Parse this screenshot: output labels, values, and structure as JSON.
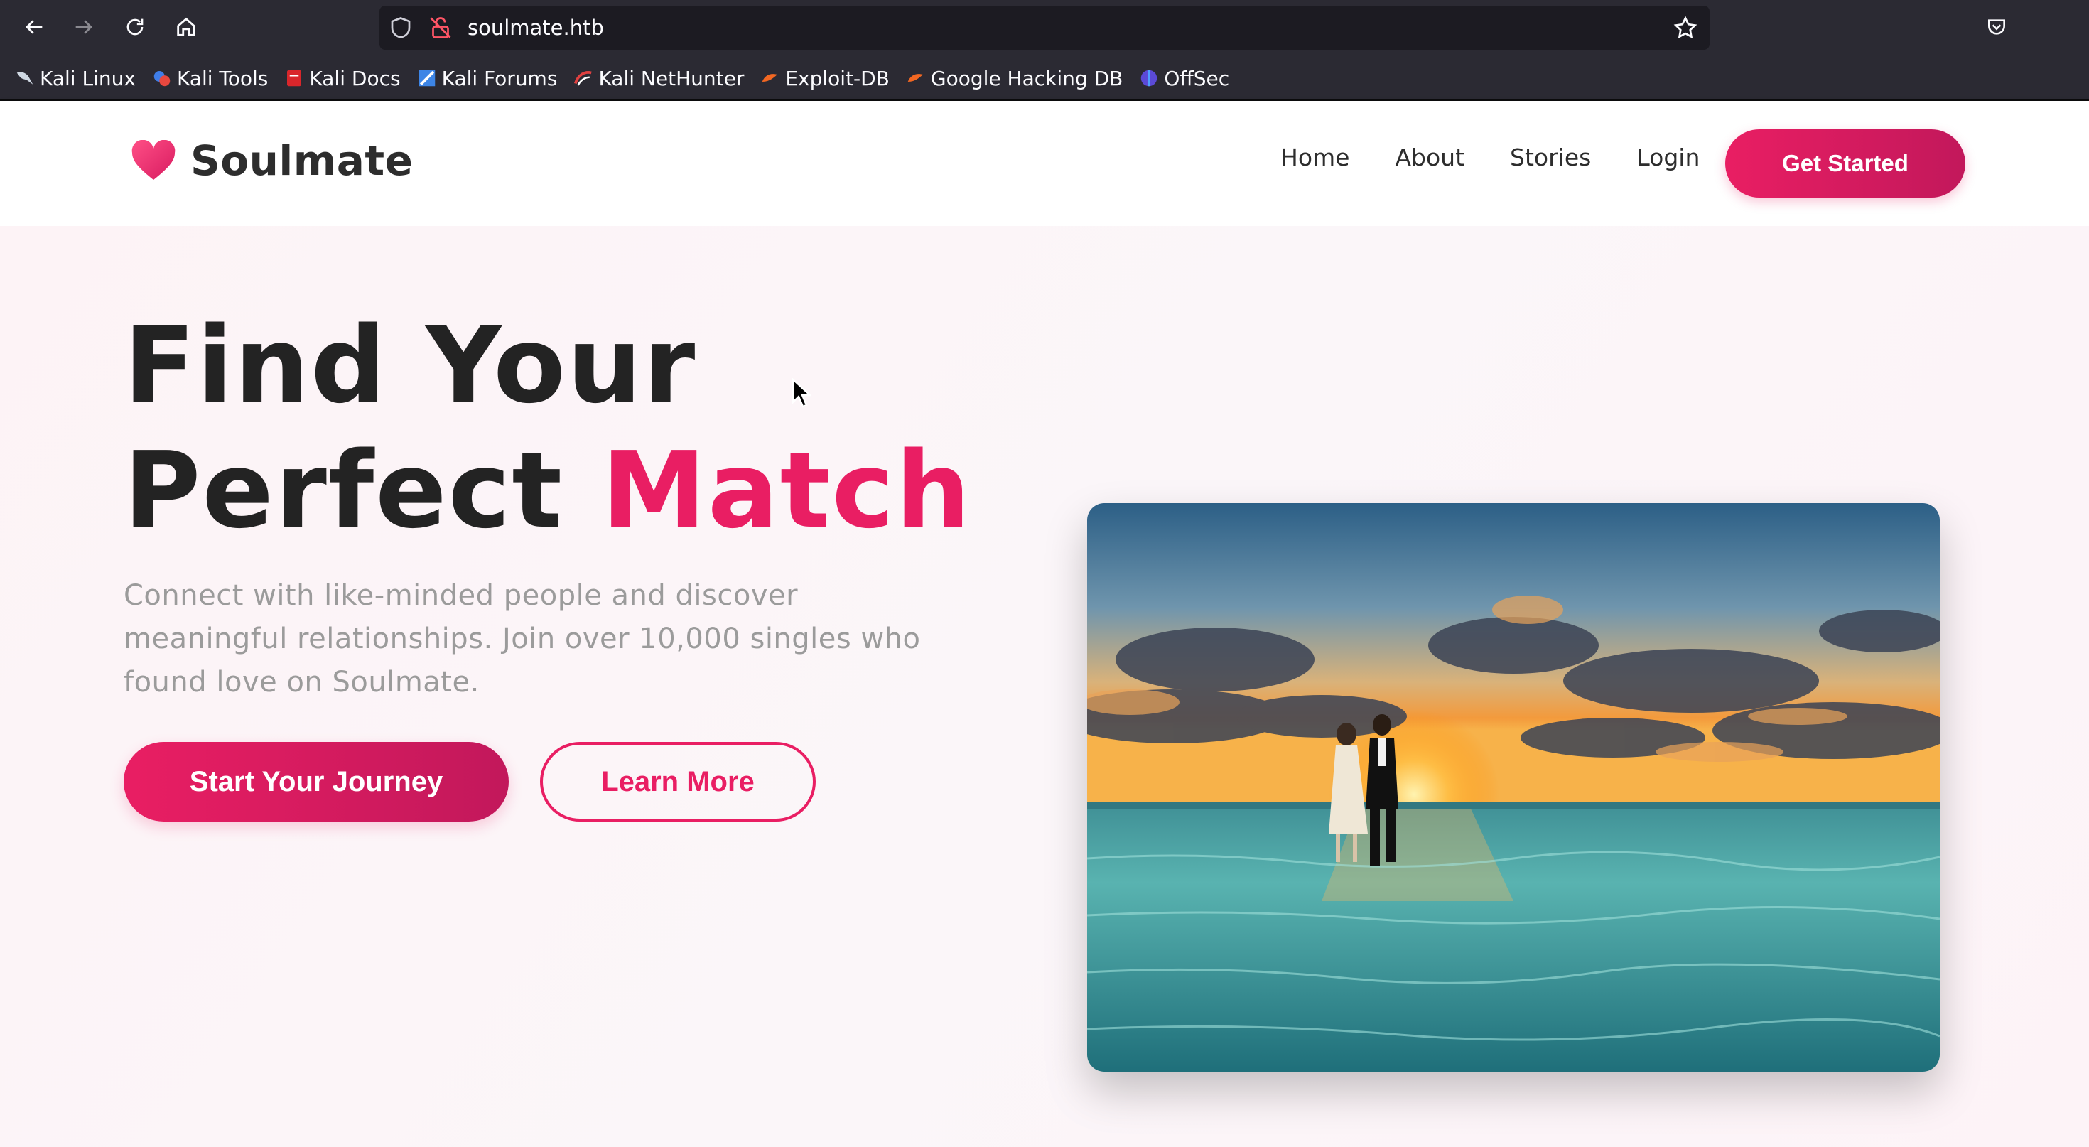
{
  "browser": {
    "url": "soulmate.htb",
    "bookmarks": [
      {
        "label": "Kali Linux",
        "icon": "kali-dragon-icon"
      },
      {
        "label": "Kali Tools",
        "icon": "kali-tools-icon"
      },
      {
        "label": "Kali Docs",
        "icon": "kali-docs-icon"
      },
      {
        "label": "Kali Forums",
        "icon": "kali-forums-icon"
      },
      {
        "label": "Kali NetHunter",
        "icon": "nethunter-icon"
      },
      {
        "label": "Exploit-DB",
        "icon": "exploit-db-icon"
      },
      {
        "label": "Google Hacking DB",
        "icon": "ghdb-icon"
      },
      {
        "label": "OffSec",
        "icon": "offsec-icon"
      }
    ]
  },
  "site": {
    "brand": "Soulmate",
    "nav": {
      "home": "Home",
      "about": "About",
      "stories": "Stories",
      "login": "Login"
    },
    "cta": "Get Started"
  },
  "hero": {
    "title_line1": "Find Your",
    "title_line2_prefix": "Perfect ",
    "title_accent": "Match",
    "subtitle": "Connect with like-minded people and discover meaningful relationships. Join over 10,000 singles who found love on Soulmate.",
    "primary_button": "Start Your Journey",
    "secondary_button": "Learn More",
    "image_alt": "couple walking on beach at sunset"
  },
  "colors": {
    "accent": "#e91e63",
    "accent_dark": "#c2185b",
    "chrome_bg": "#2b2a33",
    "text_dark": "#232323"
  }
}
